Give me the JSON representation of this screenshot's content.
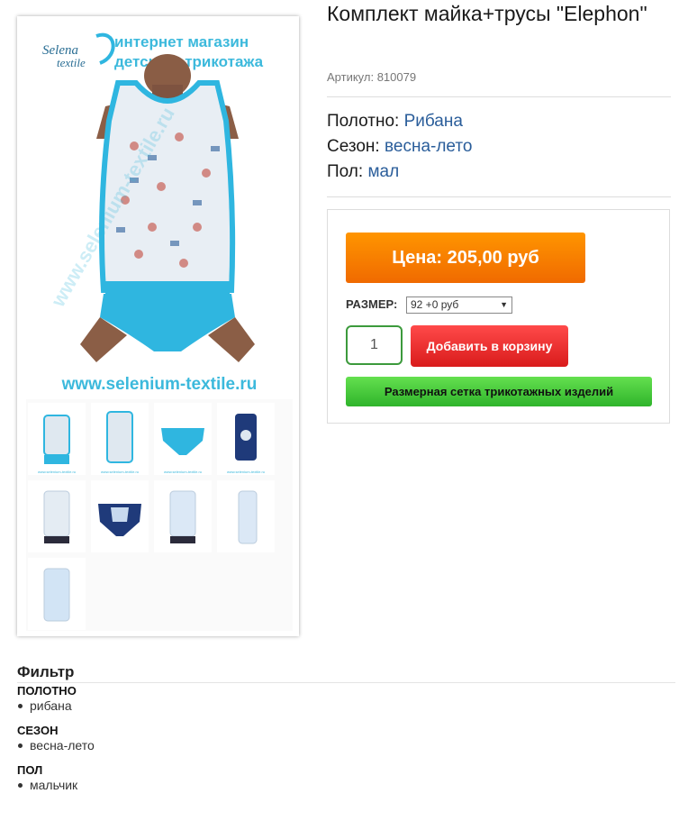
{
  "product": {
    "title": "Комплект майка+трусы \"Elephon\"",
    "article": "Артикул: 810079",
    "specs": [
      {
        "label": "Полотно:",
        "value": "Рибана"
      },
      {
        "label": "Сезон:",
        "value": "весна-лето"
      },
      {
        "label": "Пол:",
        "value": "мал"
      }
    ]
  },
  "gallery": {
    "logo_brand": "Selena textile",
    "logo_line1": "интернет магазин",
    "logo_line2": "детского трикотажа",
    "watermark": "www.selenium-textile.ru",
    "thumb_count": 9,
    "thumb_url": "www.selenium-textile.ru"
  },
  "buy": {
    "price": "Цена: 205,00 руб",
    "size_label": "РАЗМЕР:",
    "size_selected": "92 +0 руб",
    "quantity": "1",
    "add_to_cart": "Добавить в корзину",
    "size_chart": "Размерная сетка трикотажных изделий"
  },
  "filter": {
    "title": "Фильтр",
    "groups": [
      {
        "title": "ПОЛОТНО",
        "item": "рибана"
      },
      {
        "title": "СЕЗОН",
        "item": "весна-лето"
      },
      {
        "title": "ПОЛ",
        "item": "мальчик"
      }
    ]
  },
  "colors": {
    "price_orange": "#f07d00",
    "cart_red": "#e52727",
    "size_chart_green": "#3fc636",
    "link_blue": "#2a5d9a",
    "garment_cyan": "#2fb6e0"
  }
}
